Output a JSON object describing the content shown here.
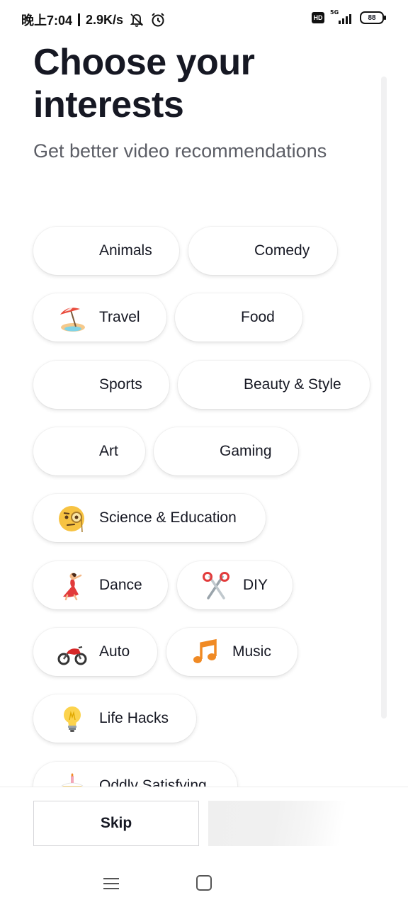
{
  "status_bar": {
    "time": "晚上7:04",
    "speed": "2.9K/s",
    "network": "5G",
    "battery": "88",
    "hd": "HD",
    "icons": [
      "mute-icon",
      "alarm-icon",
      "hd-icon",
      "signal-icon",
      "battery-icon"
    ]
  },
  "header": {
    "title": "Choose your interests",
    "subtitle": "Get better video recommendations"
  },
  "interests": [
    {
      "label": "Animals",
      "emoji": null
    },
    {
      "label": "Comedy",
      "emoji": null
    },
    {
      "label": "Travel",
      "emoji": "beach-umbrella-icon"
    },
    {
      "label": "Food",
      "emoji": null
    },
    {
      "label": "Sports",
      "emoji": null
    },
    {
      "label": "Beauty & Style",
      "emoji": null
    },
    {
      "label": "Art",
      "emoji": null
    },
    {
      "label": "Gaming",
      "emoji": null
    },
    {
      "label": "Science & Education",
      "emoji": "face-with-monocle-icon"
    },
    {
      "label": "Dance",
      "emoji": "dancer-icon"
    },
    {
      "label": "DIY",
      "emoji": "scissors-icon"
    },
    {
      "label": "Auto",
      "emoji": "motorcycle-icon"
    },
    {
      "label": "Music",
      "emoji": "music-notes-icon"
    },
    {
      "label": "Life Hacks",
      "emoji": "light-bulb-icon"
    },
    {
      "label": "Oddly Satisfying",
      "emoji": "cake-icon"
    }
  ],
  "footer": {
    "skip_label": "Skip"
  },
  "nav": {
    "icons": [
      "menu-icon",
      "home-icon"
    ]
  },
  "colors": {
    "text": "#161823",
    "subtitle": "#5c5e66",
    "chip_bg": "#ffffff"
  }
}
